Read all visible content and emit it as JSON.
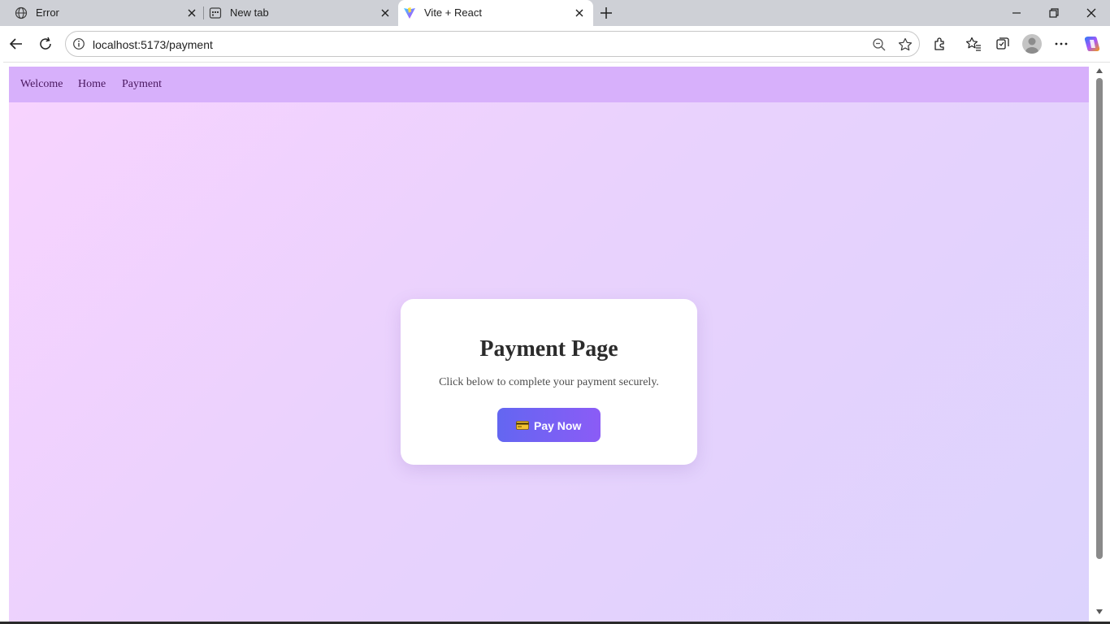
{
  "browser": {
    "tabs": [
      {
        "title": "Error",
        "icon": "globe-icon",
        "active": false
      },
      {
        "title": "New tab",
        "icon": "new-tab-page-icon",
        "active": false
      },
      {
        "title": "Vite + React",
        "icon": "vite-logo-icon",
        "active": true
      }
    ],
    "address_bar": {
      "url": "localhost:5173/payment"
    },
    "colors": {
      "tabstrip": "#ced0d6",
      "copilot_gradient": [
        "#2b7cf7",
        "#a855f7",
        "#f59e0b"
      ]
    }
  },
  "app": {
    "nav": {
      "links": [
        {
          "label": "Welcome"
        },
        {
          "label": "Home"
        },
        {
          "label": "Payment"
        }
      ]
    },
    "card": {
      "title": "Payment Page",
      "description": "Click below to complete your payment securely.",
      "button_label": "Pay Now",
      "button_icon": "credit-card-icon"
    },
    "colors": {
      "navbar": "#d7b0fb",
      "nav_text": "#4a1860",
      "background_gradient": [
        "#f8d3fe",
        "#dcd3fd"
      ],
      "button_gradient": [
        "#6366f1",
        "#8b5cf6"
      ]
    }
  }
}
